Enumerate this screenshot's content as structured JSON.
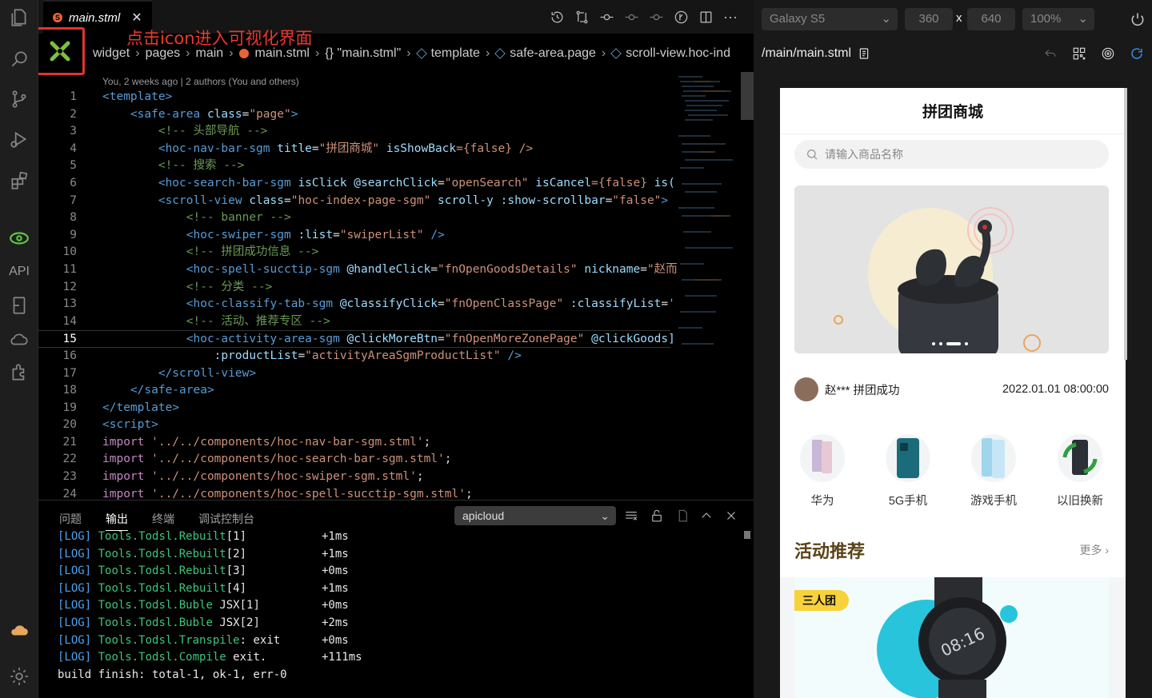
{
  "editor": {
    "tab": {
      "name": "main.stml",
      "file_badge": "S",
      "close": "✕"
    },
    "visual_hint": "点击icon进入可视化界面",
    "breadcrumb": [
      "widget",
      "pages",
      "main",
      "main.stml",
      "{} \"main.stml\"",
      "template",
      "safe-area.page",
      "scroll-view.hoc-ind"
    ],
    "blame": "You, 2 weeks ago | 2 authors (You and others)",
    "toolbar_icons": [
      "history-icon",
      "compare-icon",
      "git-commit-icon",
      "git-prev-icon",
      "git-next-icon",
      "timeline-icon",
      "split-editor-icon",
      "more-icon"
    ],
    "code_lines": [
      {
        "n": "1",
        "tokens": [
          {
            "t": "<template>",
            "c": "tg"
          }
        ]
      },
      {
        "n": "2",
        "tokens": [
          {
            "t": "    <safe-area ",
            "c": "tg"
          },
          {
            "t": "class",
            "c": "at"
          },
          {
            "t": "=",
            "c": "pl"
          },
          {
            "t": "\"page\"",
            "c": "st"
          },
          {
            "t": ">",
            "c": "tg"
          }
        ]
      },
      {
        "n": "3",
        "tokens": [
          {
            "t": "        <!-- 头部导航 -->",
            "c": "cm"
          }
        ]
      },
      {
        "n": "4",
        "tokens": [
          {
            "t": "        <hoc-nav-bar-sgm ",
            "c": "tg"
          },
          {
            "t": "title",
            "c": "at"
          },
          {
            "t": "=",
            "c": "pl"
          },
          {
            "t": "\"拼团商城\" ",
            "c": "st"
          },
          {
            "t": "isShowBack",
            "c": "at"
          },
          {
            "t": "={false} />",
            "c": "st"
          }
        ]
      },
      {
        "n": "5",
        "tokens": [
          {
            "t": "        <!-- 搜索 -->",
            "c": "cm"
          }
        ]
      },
      {
        "n": "6",
        "tokens": [
          {
            "t": "        <hoc-search-bar-sgm ",
            "c": "tg"
          },
          {
            "t": "isClick @searchClick",
            "c": "at"
          },
          {
            "t": "=",
            "c": "pl"
          },
          {
            "t": "\"openSearch\" ",
            "c": "st"
          },
          {
            "t": "isCancel",
            "c": "at"
          },
          {
            "t": "={false} ",
            "c": "st"
          },
          {
            "t": "is(",
            "c": "at"
          }
        ]
      },
      {
        "n": "7",
        "tokens": [
          {
            "t": "        <scroll-view ",
            "c": "tg"
          },
          {
            "t": "class",
            "c": "at"
          },
          {
            "t": "=",
            "c": "pl"
          },
          {
            "t": "\"hoc-index-page-sgm\" ",
            "c": "st"
          },
          {
            "t": "scroll-y :show-scrollbar",
            "c": "at"
          },
          {
            "t": "=",
            "c": "pl"
          },
          {
            "t": "\"false\"",
            "c": "st"
          },
          {
            "t": ">",
            "c": "tg"
          }
        ]
      },
      {
        "n": "8",
        "tokens": [
          {
            "t": "            <!-- banner -->",
            "c": "cm"
          }
        ]
      },
      {
        "n": "9",
        "tokens": [
          {
            "t": "            <hoc-swiper-sgm ",
            "c": "tg"
          },
          {
            "t": ":list",
            "c": "at"
          },
          {
            "t": "=",
            "c": "pl"
          },
          {
            "t": "\"swiperList\" ",
            "c": "st"
          },
          {
            "t": "/>",
            "c": "tg"
          }
        ]
      },
      {
        "n": "10",
        "tokens": [
          {
            "t": "            <!-- 拼团成功信息 -->",
            "c": "cm"
          }
        ]
      },
      {
        "n": "11",
        "tokens": [
          {
            "t": "            <hoc-spell-succtip-sgm ",
            "c": "tg"
          },
          {
            "t": "@handleClick",
            "c": "at"
          },
          {
            "t": "=",
            "c": "pl"
          },
          {
            "t": "\"fnOpenGoodsDetails\" ",
            "c": "st"
          },
          {
            "t": "nickname",
            "c": "at"
          },
          {
            "t": "=",
            "c": "pl"
          },
          {
            "t": "\"赵而",
            "c": "st"
          }
        ]
      },
      {
        "n": "12",
        "tokens": [
          {
            "t": "            <!-- 分类 -->",
            "c": "cm"
          }
        ]
      },
      {
        "n": "13",
        "tokens": [
          {
            "t": "            <hoc-classify-tab-sgm ",
            "c": "tg"
          },
          {
            "t": "@classifyClick",
            "c": "at"
          },
          {
            "t": "=",
            "c": "pl"
          },
          {
            "t": "\"fnOpenClassPage\" ",
            "c": "st"
          },
          {
            "t": ":classifyList",
            "c": "at"
          },
          {
            "t": "=",
            "c": "pl"
          },
          {
            "t": "'",
            "c": "st"
          }
        ]
      },
      {
        "n": "14",
        "tokens": [
          {
            "t": "            <!-- 活动、推荐专区 -->",
            "c": "cm"
          }
        ]
      },
      {
        "n": "15",
        "tokens": [
          {
            "t": "            <hoc-activity-area-sgm ",
            "c": "tg"
          },
          {
            "t": "@clickMoreBtn",
            "c": "at"
          },
          {
            "t": "=",
            "c": "pl"
          },
          {
            "t": "\"fnOpenMoreZonePage\" ",
            "c": "st"
          },
          {
            "t": "@clickGoods]",
            "c": "at"
          }
        ]
      },
      {
        "n": "16",
        "tokens": [
          {
            "t": "                :productList",
            "c": "at"
          },
          {
            "t": "=",
            "c": "pl"
          },
          {
            "t": "\"activityAreaSgmProductList\" ",
            "c": "st"
          },
          {
            "t": "/>",
            "c": "tg"
          }
        ]
      },
      {
        "n": "17",
        "tokens": [
          {
            "t": "        </scroll-view>",
            "c": "tg"
          }
        ]
      },
      {
        "n": "18",
        "tokens": [
          {
            "t": "    </safe-area>",
            "c": "tg"
          }
        ]
      },
      {
        "n": "19",
        "tokens": [
          {
            "t": "</template>",
            "c": "tg"
          }
        ]
      },
      {
        "n": "20",
        "tokens": [
          {
            "t": "<script>",
            "c": "tg"
          }
        ]
      },
      {
        "n": "21",
        "tokens": [
          {
            "t": "import ",
            "c": "kw"
          },
          {
            "t": "'../../components/hoc-nav-bar-sgm.stml'",
            "c": "st"
          },
          {
            "t": ";",
            "c": "pl"
          }
        ]
      },
      {
        "n": "22",
        "tokens": [
          {
            "t": "import ",
            "c": "kw"
          },
          {
            "t": "'../../components/hoc-search-bar-sgm.stml'",
            "c": "st"
          },
          {
            "t": ";",
            "c": "pl"
          }
        ]
      },
      {
        "n": "23",
        "tokens": [
          {
            "t": "import ",
            "c": "kw"
          },
          {
            "t": "'../../components/hoc-swiper-sgm.stml'",
            "c": "st"
          },
          {
            "t": ";",
            "c": "pl"
          }
        ]
      },
      {
        "n": "24",
        "tokens": [
          {
            "t": "import ",
            "c": "kw"
          },
          {
            "t": "'../../components/hoc-spell-succtip-sgm.stml'",
            "c": "st"
          },
          {
            "t": ";",
            "c": "pl"
          }
        ]
      }
    ],
    "current_line": "15"
  },
  "panel": {
    "tabs": [
      "问题",
      "输出",
      "终端",
      "调试控制台"
    ],
    "active_tab": "输出",
    "channel": "apicloud",
    "log_lines": [
      {
        "lvl": "[LOG]",
        "fn": "Tools.Todsl.Rebuilt",
        "rest": "[1]",
        "time": "+1ms"
      },
      {
        "lvl": "[LOG]",
        "fn": "Tools.Todsl.Rebuilt",
        "rest": "[2]",
        "time": "+1ms"
      },
      {
        "lvl": "[LOG]",
        "fn": "Tools.Todsl.Rebuilt",
        "rest": "[3]",
        "time": "+0ms"
      },
      {
        "lvl": "[LOG]",
        "fn": "Tools.Todsl.Rebuilt",
        "rest": "[4]",
        "time": "+1ms"
      },
      {
        "lvl": "[LOG]",
        "fn": "Tools.Todsl.Buble",
        "rest": " JSX[1]",
        "time": "+0ms"
      },
      {
        "lvl": "[LOG]",
        "fn": "Tools.Todsl.Buble",
        "rest": " JSX[2]",
        "time": "+2ms"
      },
      {
        "lvl": "[LOG]",
        "fn": "Tools.Todsl.Transpile",
        "rest": ": exit",
        "time": "+0ms"
      },
      {
        "lvl": "[LOG]",
        "fn": "Tools.Todsl.Compile",
        "rest": " exit.",
        "time": "+111ms"
      }
    ],
    "finish": "build finish: total-1, ok-1, err-0"
  },
  "simulator": {
    "device": "Galaxy S5",
    "width": "360",
    "x": "x",
    "height": "640",
    "zoom": "100%",
    "path": "/main/main.stml",
    "app": {
      "title": "拼团商城",
      "search_placeholder": "请输入商品名称",
      "success_text": "赵*** 拼团成功",
      "success_time": "2022.01.01 08:00:00",
      "categories": [
        "华为",
        "5G手机",
        "游戏手机",
        "以旧换新"
      ],
      "section_title": "活动推荐",
      "section_more": "更多",
      "badge": "三人团",
      "banner_page": "3 of 4"
    }
  },
  "colors": {
    "accent_red": "#e0352b",
    "tag": "#569cd6",
    "string": "#ce9178",
    "comment": "#6a9955",
    "attr": "#9cdcfe",
    "keyword": "#c586c0",
    "badge": "#f7d23a",
    "section": "#5a4318"
  }
}
